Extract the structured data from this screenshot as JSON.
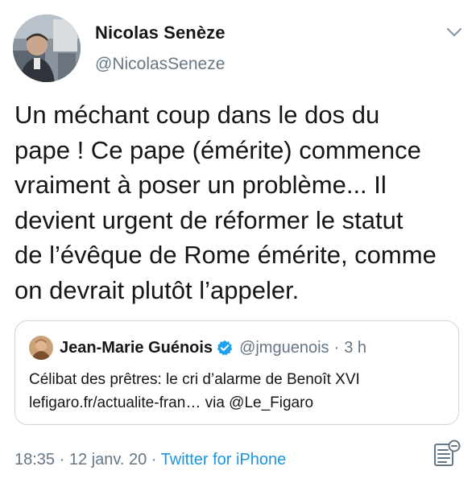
{
  "author": {
    "name": "Nicolas Senèze",
    "handle": "@NicolasSeneze"
  },
  "tweet": {
    "text": "Un méchant coup dans le dos du\npape ! Ce pape (émérite) commence\nvraiment à poser un problème... Il\ndevient urgent de réformer le statut\nde l’évêque de Rome émérite, comme\non devrait plutôt l’appeler."
  },
  "quoted_tweet": {
    "name": "Jean-Marie Guénois",
    "handle": "@jmguenois",
    "separator": "·",
    "time": "3 h",
    "line1": "Célibat des prêtres: le cri d’alarme de Benoît XVI",
    "link": "lefigaro.fr/actualite-fran…",
    "via": " via @Le_Figaro"
  },
  "meta": {
    "time": "18:35",
    "sep1": " · ",
    "date": "12 janv. 20",
    "sep2": " · ",
    "source": "Twitter for iPhone"
  },
  "colors": {
    "primary_text": "#14171a",
    "secondary_text": "#657786",
    "link_blue": "#1b95e0",
    "border": "#ccd6dd",
    "verified_blue": "#1da1f2"
  },
  "icons": {
    "menu": "chevron-down-icon",
    "verified": "verified-badge-icon",
    "analytics": "analytics-icon"
  }
}
